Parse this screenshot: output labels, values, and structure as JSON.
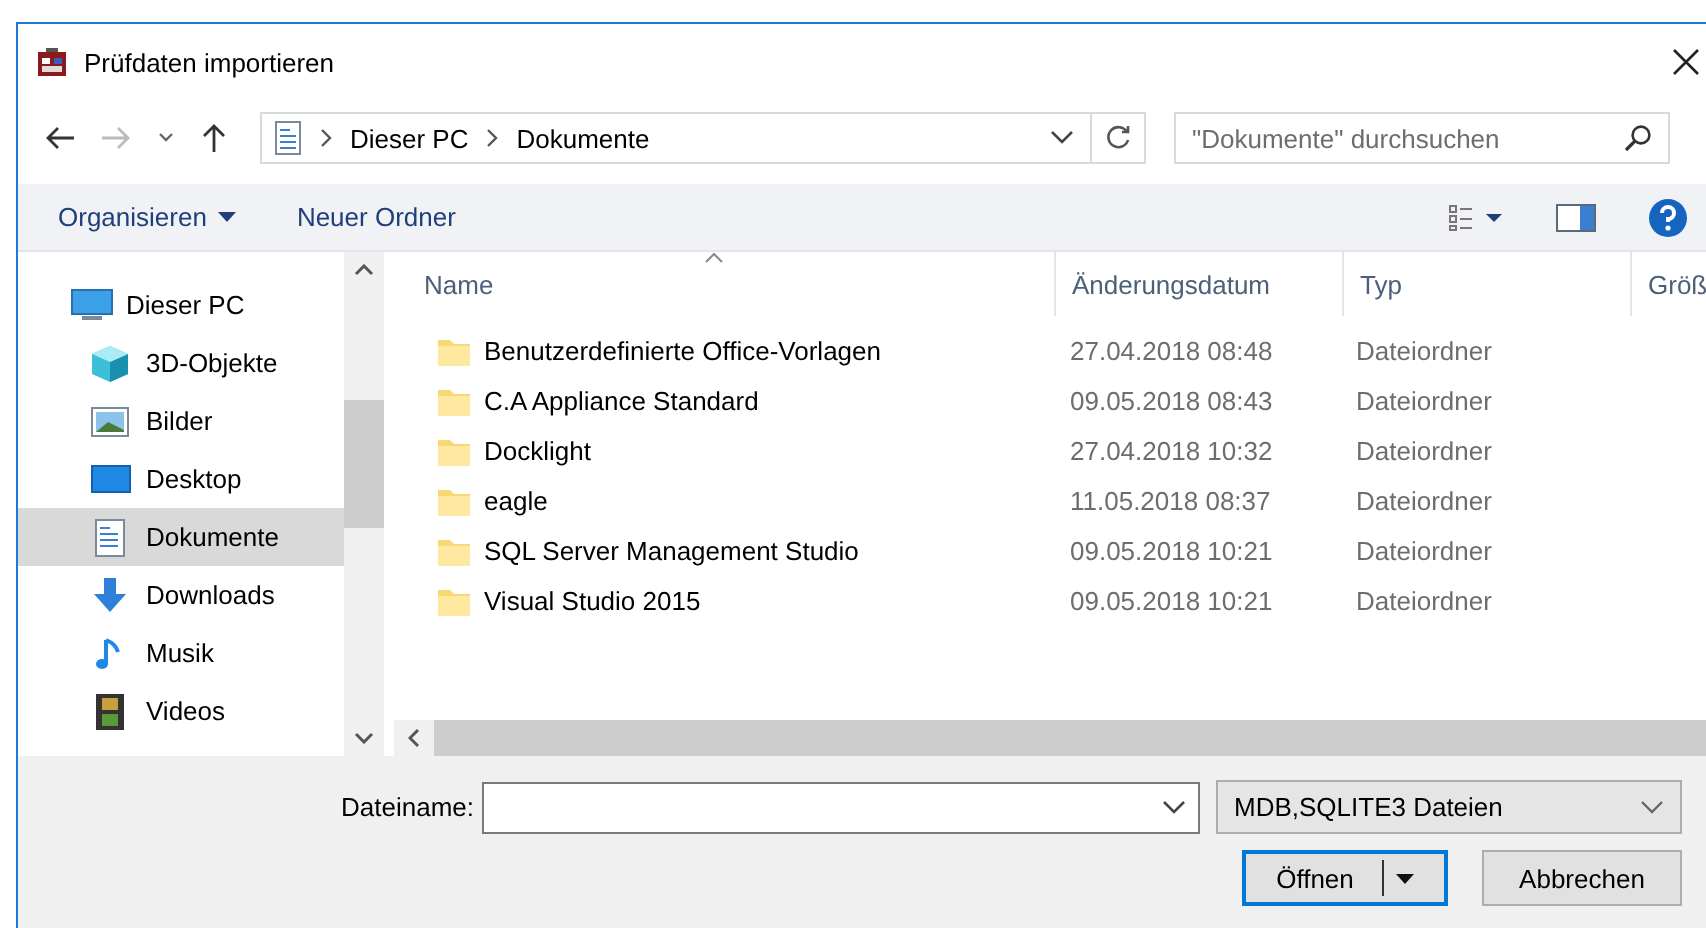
{
  "window": {
    "title": "Prüfdaten importieren"
  },
  "address": {
    "path": [
      "Dieser PC",
      "Dokumente"
    ]
  },
  "search": {
    "placeholder": "\"Dokumente\" durchsuchen"
  },
  "toolbar": {
    "items": [
      "Organisieren",
      "Neuer Ordner"
    ]
  },
  "sidebar": {
    "items": [
      {
        "label": "Dieser PC",
        "kind": "pc",
        "selected": false,
        "children": [
          {
            "label": "3D-Objekte",
            "kind": "cube",
            "selected": false
          },
          {
            "label": "Bilder",
            "kind": "pictures",
            "selected": false
          },
          {
            "label": "Desktop",
            "kind": "desktop",
            "selected": false
          },
          {
            "label": "Dokumente",
            "kind": "documents",
            "selected": true
          },
          {
            "label": "Downloads",
            "kind": "downloads",
            "selected": false
          },
          {
            "label": "Musik",
            "kind": "music",
            "selected": false
          },
          {
            "label": "Videos",
            "kind": "videos",
            "selected": false
          }
        ]
      }
    ]
  },
  "table": {
    "columns": [
      "Name",
      "Änderungsdatum",
      "Typ",
      "Größ"
    ],
    "rows": [
      [
        "Benutzerdefinierte Office-Vorlagen",
        "27.04.2018 08:48",
        "Dateiordner"
      ],
      [
        "C.A Appliance Standard",
        "09.05.2018 08:43",
        "Dateiordner"
      ],
      [
        "Docklight",
        "27.04.2018 10:32",
        "Dateiordner"
      ],
      [
        "eagle",
        "11.05.2018 08:37",
        "Dateiordner"
      ],
      [
        "SQL Server Management Studio",
        "09.05.2018 10:21",
        "Dateiordner"
      ],
      [
        "Visual Studio 2015",
        "09.05.2018 10:21",
        "Dateiordner"
      ]
    ]
  },
  "footer": {
    "filename_label": "Dateiname:",
    "file_type": "MDB,SQLITE3 Dateien",
    "buttons": [
      "Öffnen",
      "Abbrechen"
    ]
  }
}
